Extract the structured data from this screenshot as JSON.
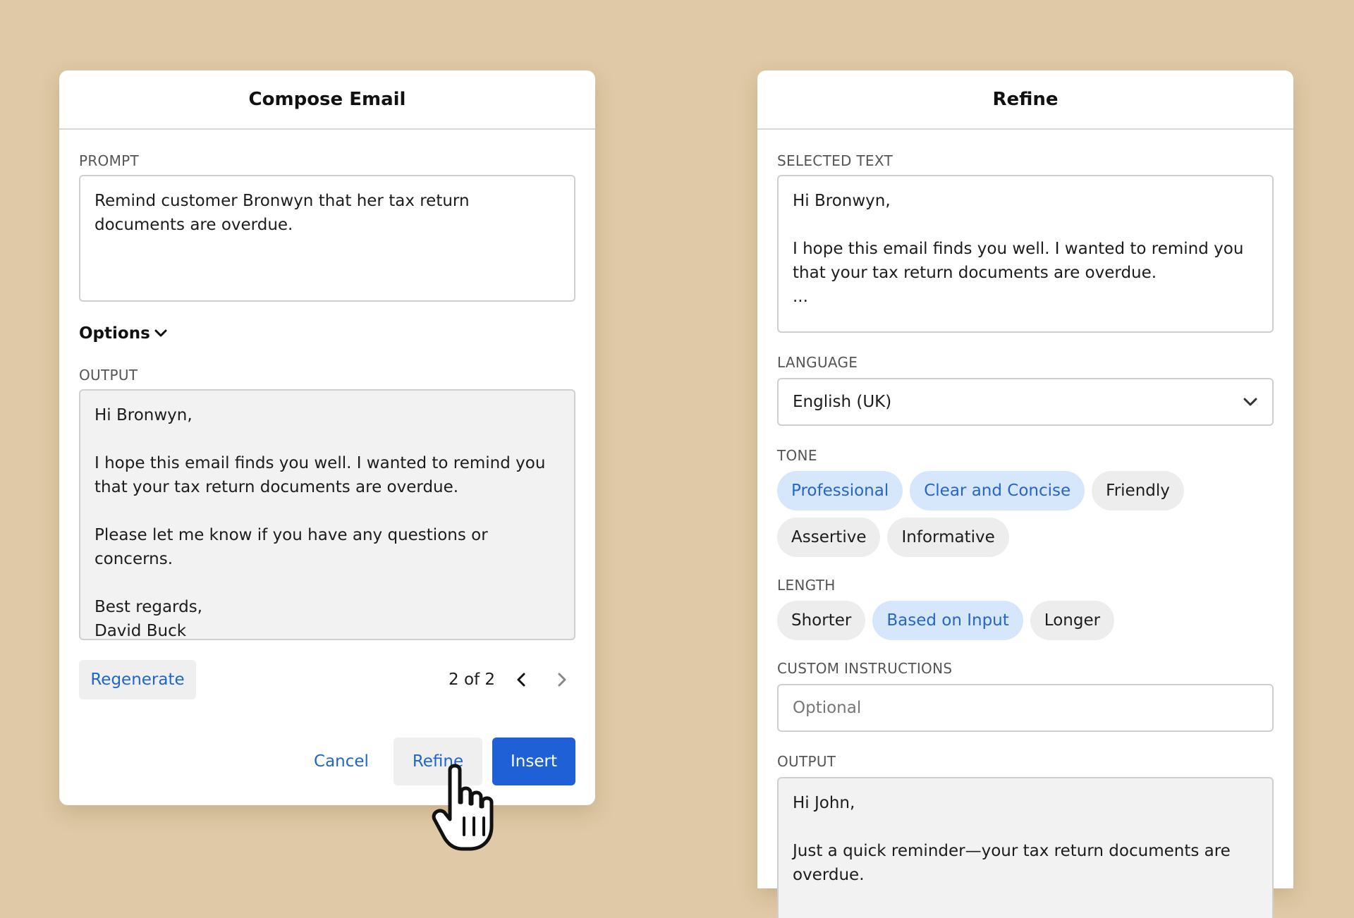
{
  "compose": {
    "title": "Compose Email",
    "prompt_label": "PROMPT",
    "prompt_value": "Remind customer Bronwyn that her tax return documents are overdue.",
    "options_label": "Options",
    "output_label": "OUTPUT",
    "output_value": "Hi Bronwyn,\n\nI hope this email finds you well. I wanted to remind you that your tax return documents are overdue.\n\nPlease let me know if you have any questions or concerns.\n\nBest regards,\nDavid Buck",
    "regenerate_label": "Regenerate",
    "pager_text": "2 of 2",
    "cancel_label": "Cancel",
    "refine_label": "Refine",
    "insert_label": "Insert"
  },
  "refine": {
    "title": "Refine",
    "selected_label": "SELECTED TEXT",
    "selected_value": "Hi Bronwyn,\n\nI hope this email finds you well. I wanted to remind you that your tax return documents are overdue.\n...",
    "language_label": "LANGUAGE",
    "language_value": "English (UK)",
    "tone_label": "TONE",
    "tones": [
      {
        "label": "Professional",
        "selected": true
      },
      {
        "label": "Clear and Concise",
        "selected": true
      },
      {
        "label": "Friendly",
        "selected": false
      },
      {
        "label": "Assertive",
        "selected": false
      },
      {
        "label": "Informative",
        "selected": false
      }
    ],
    "length_label": "LENGTH",
    "lengths": [
      {
        "label": "Shorter",
        "selected": false
      },
      {
        "label": "Based on Input",
        "selected": true
      },
      {
        "label": "Longer",
        "selected": false
      }
    ],
    "custom_label": "CUSTOM INSTRUCTIONS",
    "custom_placeholder": "Optional",
    "output_label": "OUTPUT",
    "output_value": "Hi John,\n\nJust a quick reminder—your tax return documents are overdue."
  },
  "colors": {
    "background": "#e0c9a6",
    "accent": "#2060d6",
    "chip_selected_bg": "#d6e6fb"
  }
}
